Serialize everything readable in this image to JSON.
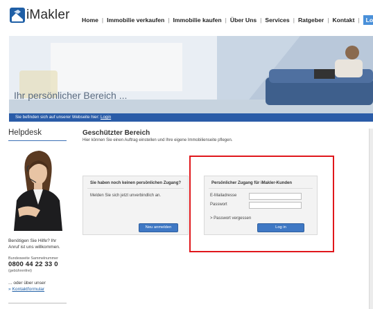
{
  "brand": {
    "logo_text": "iMakler"
  },
  "nav": {
    "items": [
      "Home",
      "Immobilie verkaufen",
      "Immobilie kaufen",
      "Über Uns",
      "Services",
      "Ratgeber",
      "Kontakt"
    ],
    "login": "Login"
  },
  "banner": {
    "title": "Ihr persönlicher Bereich ...",
    "info_text": "Sie befinden sich auf unserer Webseite hier:",
    "info_link": "Login"
  },
  "sidebar": {
    "title": "Helpdesk",
    "help_text_1": "Benötigen Sie Hilfe? Ihr",
    "help_text_2": "Anruf ist uns willkommen.",
    "phone_label": "Bundesweite Sammelnummer",
    "phone": "0800 44 22 33 0",
    "phone_note": "(gebührenfrei)",
    "or_text": "... oder über unser",
    "contact_link": "Kontaktformular"
  },
  "main": {
    "title": "Geschützter Bereich",
    "subtitle": "Hier können Sie einen Auftrag einstellen und Ihre eigene Immobilienseite pflegen."
  },
  "register_panel": {
    "heading": "Sie haben noch keinen persönlichen Zugang?",
    "text": "Melden Sie sich jetzt unverbindlich an.",
    "button": "Neu anmelden"
  },
  "login_panel": {
    "heading": "Persönlicher Zugang für iMakler-Kunden",
    "email_label": "E-Mailadresse",
    "password_label": "Passwort",
    "email_value": "",
    "password_value": "",
    "forgot": "> Passwort vergessen",
    "button": "Log in"
  },
  "colors": {
    "accent": "#1f5fa6",
    "highlight": "#e0161b",
    "button": "#3f78c4"
  }
}
